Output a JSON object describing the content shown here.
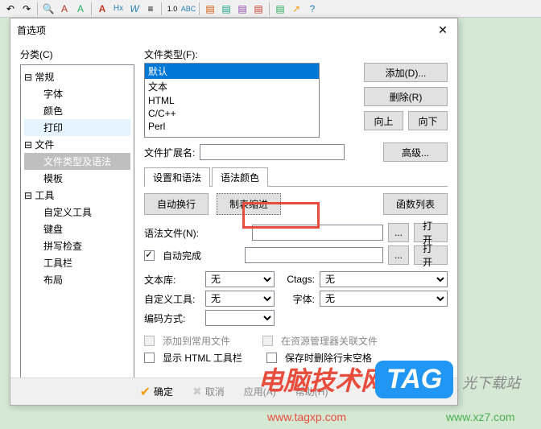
{
  "toolbar_icons": [
    "↶",
    "↷",
    "|",
    "🔍",
    "A",
    "A",
    "|",
    "A",
    "Hx",
    "W",
    "☰",
    "|",
    "10",
    "##",
    "|",
    "□",
    "□",
    "✎",
    "□",
    "|",
    "□",
    "↗",
    "?"
  ],
  "dialog": {
    "title": "首选项",
    "close": "✕",
    "left_label": "分类(C)",
    "tree": {
      "groups": [
        {
          "label": "常规",
          "items": [
            "字体",
            "颜色",
            "打印"
          ]
        },
        {
          "label": "文件",
          "items": [
            "文件类型及语法",
            "模板"
          ]
        },
        {
          "label": "工具",
          "items": [
            "自定义工具",
            "键盘",
            "拼写检查",
            "工具栏",
            "布局"
          ]
        }
      ],
      "selected": "文件类型及语法",
      "highlighted": "打印"
    },
    "right": {
      "filetype_label": "文件类型(F):",
      "filetypes": [
        "默认",
        "文本",
        "HTML",
        "C/C++",
        "Perl"
      ],
      "filetype_selected": "默认",
      "buttons": {
        "add": "添加(D)...",
        "remove": "删除(R)",
        "up": "向上",
        "down": "向下",
        "advanced": "高级..."
      },
      "ext_label": "文件扩展名:",
      "settings_label": "设置和语法",
      "tab2": "语法颜色",
      "tab_buttons": {
        "autowrap": "自动换行",
        "tabindent": "制表缩进",
        "funclist": "函数列表"
      },
      "syntax_file_label": "语法文件(N):",
      "open": "打开",
      "ellipsis": "...",
      "autocomplete": "自动完成",
      "textlib_label": "文本库:",
      "none": "无",
      "ctags_label": "Ctags:",
      "customtool_label": "自定义工具:",
      "font2_label": "字体:",
      "encoding_label": "编码方式:",
      "cb1": "添加到常用文件",
      "cb2": "在资源管理器关联文件",
      "cb3": "显示 HTML 工具栏",
      "cb4": "保存时删除行末空格"
    },
    "footer": {
      "ok": "确定",
      "cancel": "取消",
      "apply": "应用(A)",
      "help": "帮助(H)"
    }
  },
  "watermark": {
    "text": "电脑技术网",
    "site1": "www.tagxp.com",
    "tag": "TAG",
    "extra": "光下载站",
    "site2": "www.xz7.com"
  }
}
